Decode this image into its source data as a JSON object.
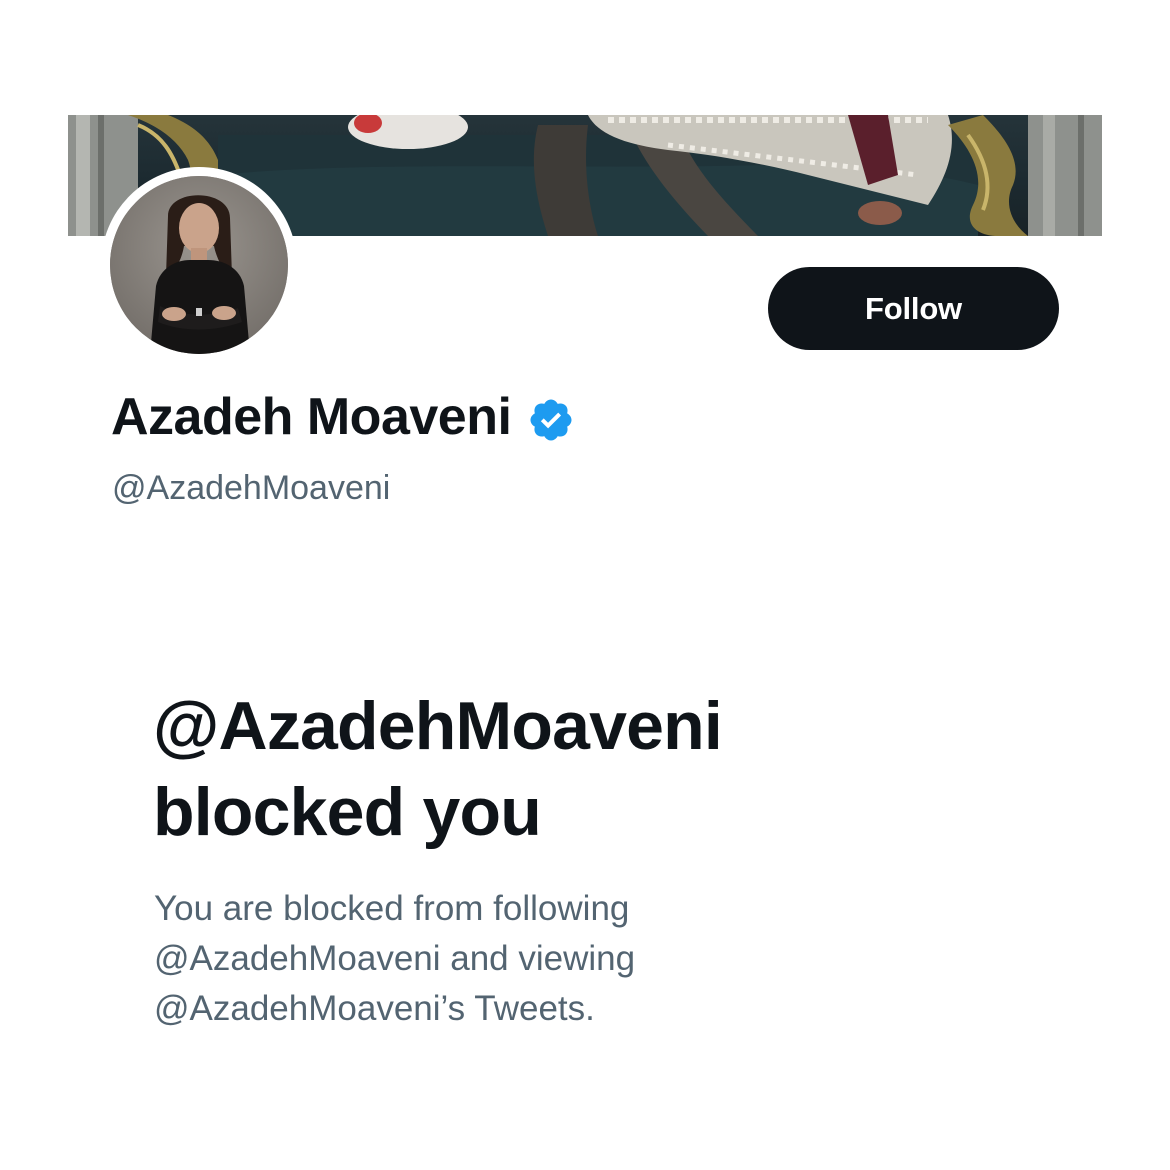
{
  "profile": {
    "display_name": "Azadeh Moaveni",
    "handle": "@AzadehMoaveni",
    "verified_icon": "verified-badge-icon",
    "follow_label": "Follow"
  },
  "blocked": {
    "title_line1": "@AzadehMoaveni",
    "title_line2": "blocked you",
    "desc_line1": "You are blocked from following",
    "desc_line2": "@AzadehMoaveni and viewing",
    "desc_line3": "@AzadehMoaveni’s Tweets."
  },
  "colors": {
    "primary_text": "#0f1419",
    "secondary_text": "#536471",
    "button_bg": "#0f1419",
    "verified_blue": "#1d9bf0"
  }
}
